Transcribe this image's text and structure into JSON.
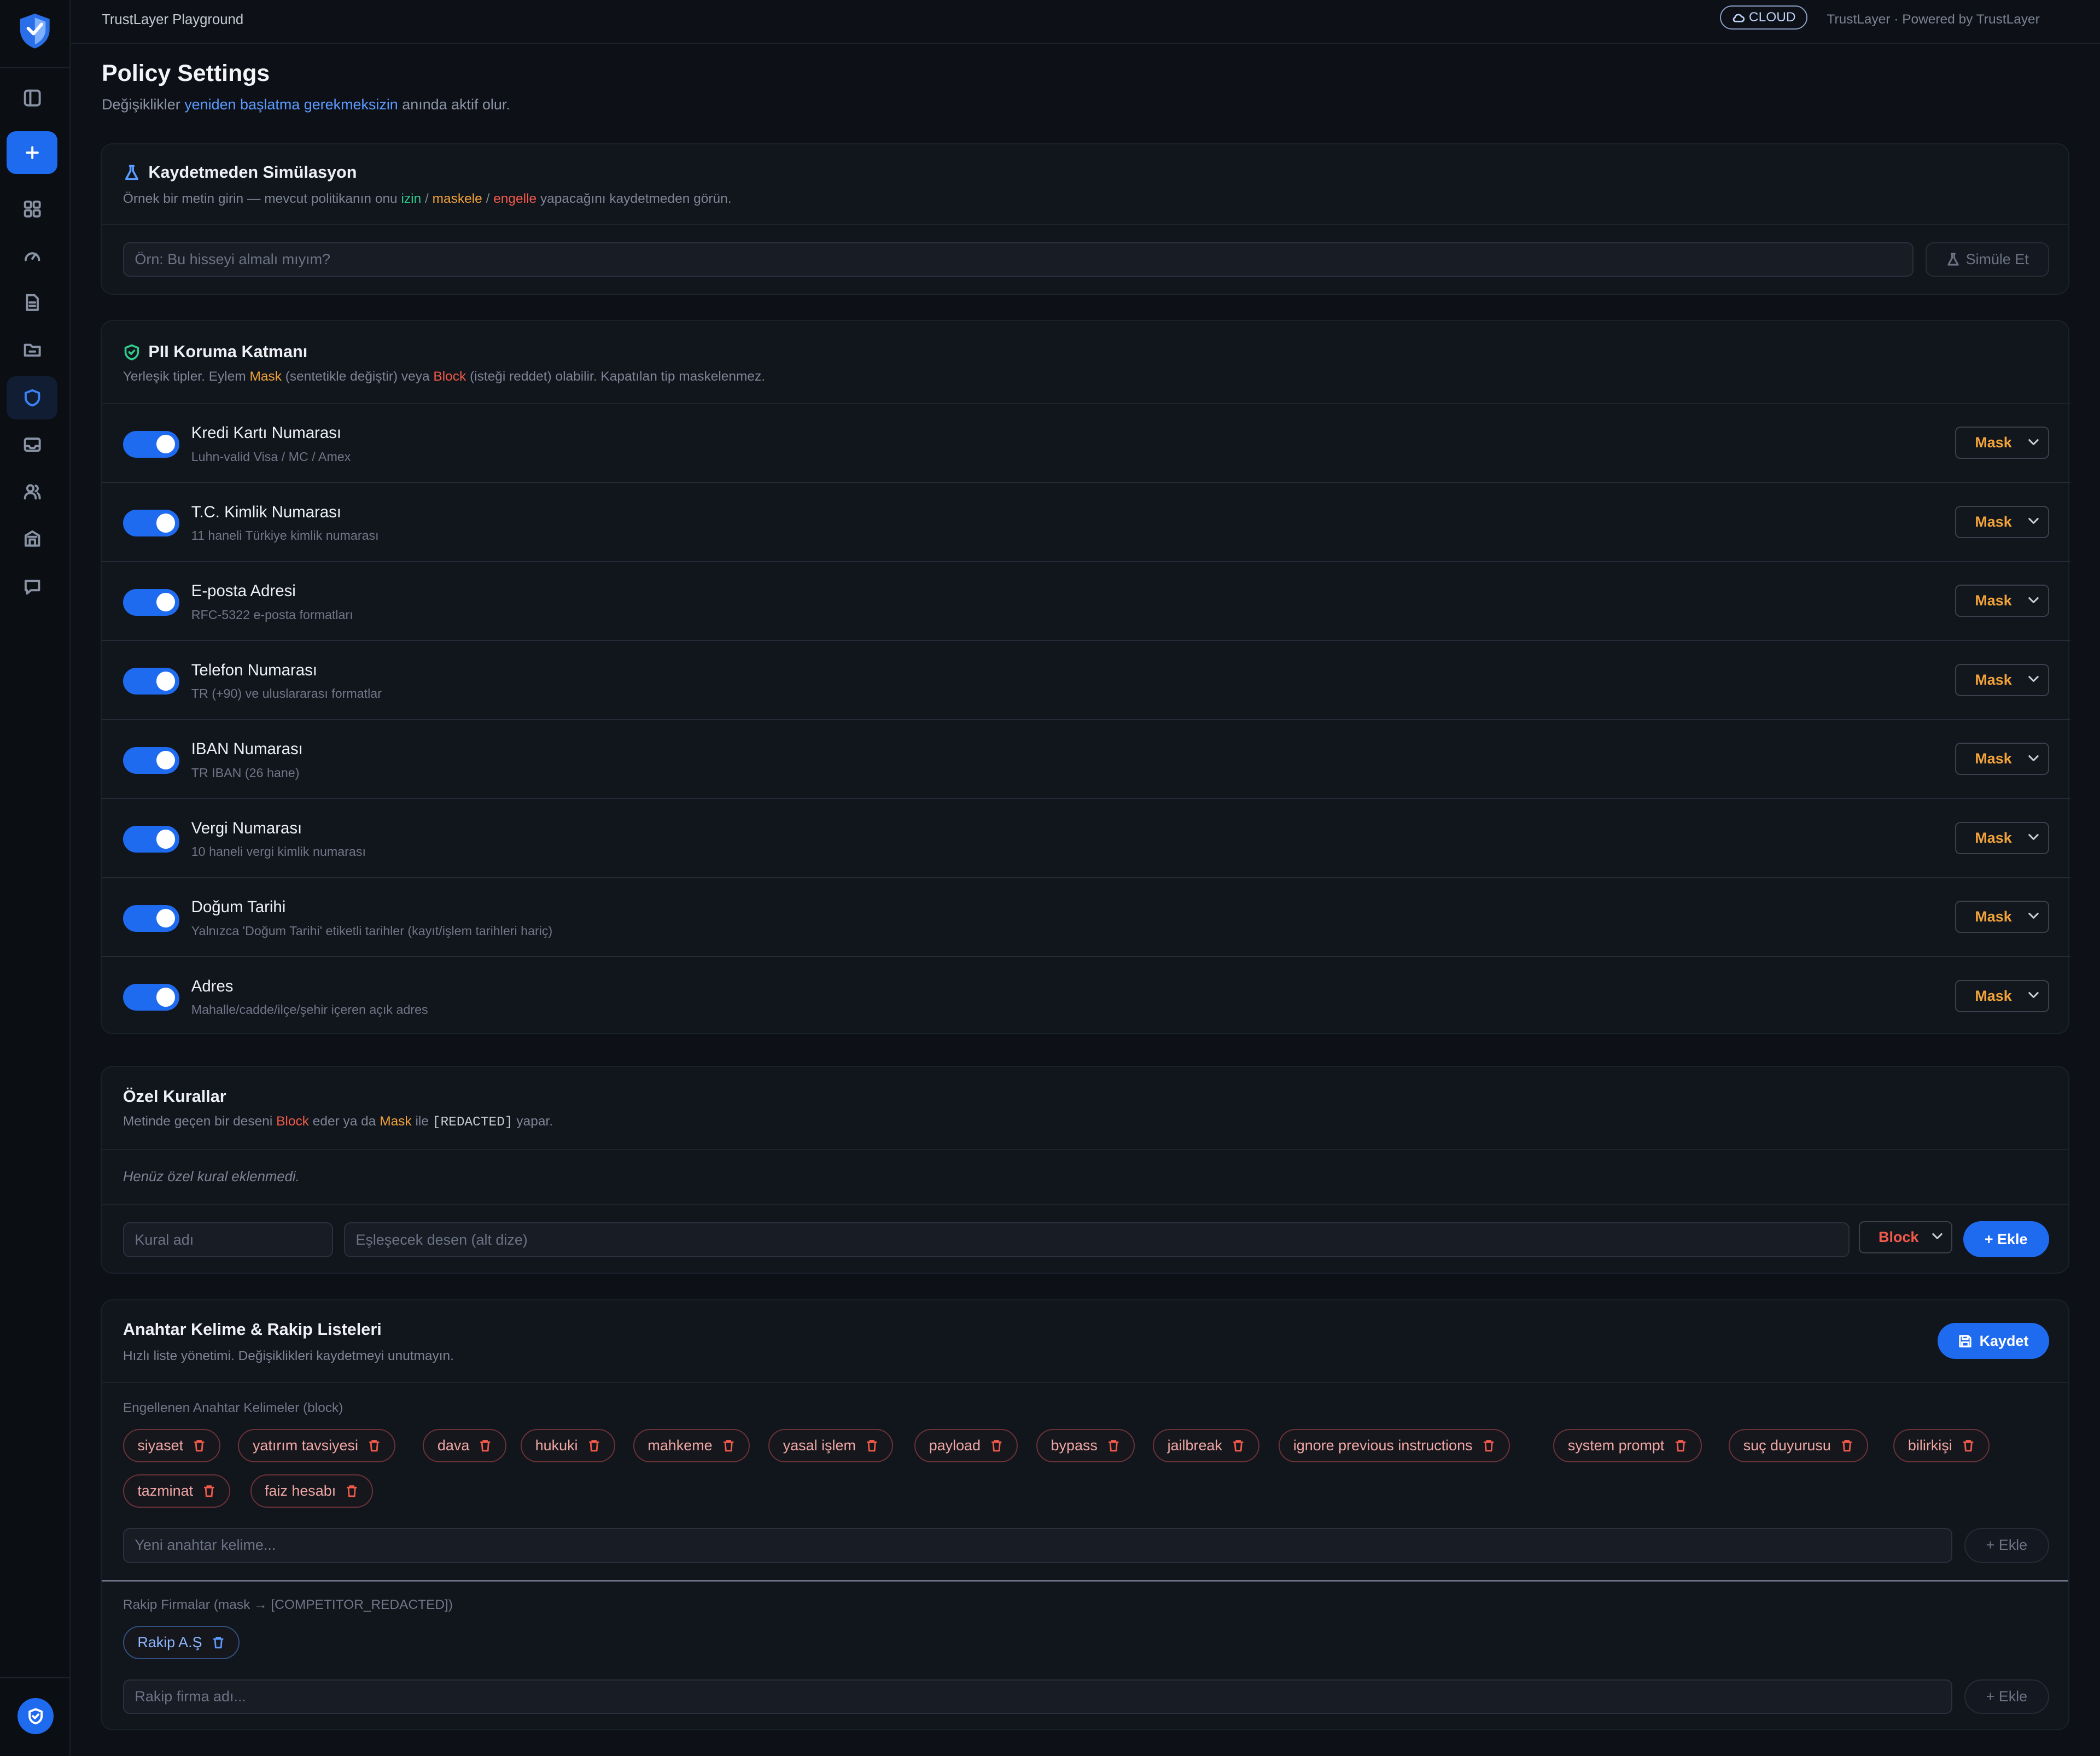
{
  "app": {
    "title": "TrustLayer Playground",
    "cloud_badge": "CLOUD",
    "powered_by": "TrustLayer · Powered by TrustLayer"
  },
  "sidebar": {
    "items": [
      "layout-icon",
      "plus-icon",
      "grid-icon",
      "gauge-icon",
      "document-icon",
      "folder-icon",
      "shield-icon",
      "inbox-icon",
      "users-icon",
      "building-icon",
      "chat-icon"
    ],
    "active": "shield-icon"
  },
  "page": {
    "title": "Policy Settings",
    "subtitle_pre": "Değişiklikler",
    "subtitle_link": "yeniden başlatma gerekmeksizin",
    "subtitle_post": "anında aktif olur."
  },
  "simulation": {
    "title": "Kaydetmeden Simülasyon",
    "desc_pre": "Örnek bir metin girin — mevcut politikanın onu",
    "desc_allow": "izin",
    "desc_sep1": "/",
    "desc_mask": "maskele",
    "desc_sep2": "/",
    "desc_block": "engelle",
    "desc_post": "yapacağını kaydetmeden görün.",
    "placeholder": "Örn: Bu hisseyi almalı mıyım?",
    "button": "Simüle Et"
  },
  "pii": {
    "title": "PII Koruma Katmanı",
    "desc_pre": "Yerleşik tipler. Eylem",
    "desc_mask": "Mask",
    "desc_mid": "(sentetikle değiştir) veya",
    "desc_block": "Block",
    "desc_post": "(isteği reddet) olabilir. Kapatılan tip maskelenmez.",
    "rows": [
      {
        "name": "Kredi Kartı Numarası",
        "desc": "Luhn-valid Visa / MC / Amex",
        "enabled": true,
        "action": "Mask"
      },
      {
        "name": "T.C. Kimlik Numarası",
        "desc": "11 haneli Türkiye kimlik numarası",
        "enabled": true,
        "action": "Mask"
      },
      {
        "name": "E-posta Adresi",
        "desc": "RFC-5322 e-posta formatları",
        "enabled": true,
        "action": "Mask"
      },
      {
        "name": "Telefon Numarası",
        "desc": "TR (+90) ve uluslararası formatlar",
        "enabled": true,
        "action": "Mask"
      },
      {
        "name": "IBAN Numarası",
        "desc": "TR IBAN (26 hane)",
        "enabled": true,
        "action": "Mask"
      },
      {
        "name": "Vergi Numarası",
        "desc": "10 haneli vergi kimlik numarası",
        "enabled": true,
        "action": "Mask"
      },
      {
        "name": "Doğum Tarihi",
        "desc": "Yalnızca 'Doğum Tarihi' etiketli tarihler (kayıt/işlem tarihleri hariç)",
        "enabled": true,
        "action": "Mask"
      },
      {
        "name": "Adres",
        "desc": "Mahalle/cadde/ilçe/şehir içeren açık adres",
        "enabled": true,
        "action": "Mask"
      }
    ]
  },
  "custom_rules": {
    "title": "Özel Kurallar",
    "desc_pre": "Metinde geçen bir deseni",
    "desc_block": "Block",
    "desc_mid": "eder ya da",
    "desc_mask": "Mask",
    "desc_mid2": "ile",
    "desc_code": "[REDACTED]",
    "desc_post": "yapar.",
    "empty": "Henüz özel kural eklenmedi.",
    "name_placeholder": "Kural adı",
    "pattern_placeholder": "Eşleşecek desen (alt dize)",
    "action": "Block",
    "add_button": "+ Ekle"
  },
  "keywords": {
    "title": "Anahtar Kelime & Rakip Listeleri",
    "desc": "Hızlı liste yönetimi. Değişiklikleri kaydetmeyi unutmayın.",
    "save_button": "Kaydet",
    "blocked_label": "Engellenen Anahtar Kelimeler (block)",
    "blocked": [
      "siyaset",
      "yatırım tavsiyesi",
      "dava",
      "hukuki",
      "mahkeme",
      "yasal işlem",
      "payload",
      "bypass",
      "jailbreak",
      "ignore previous instructions",
      "system prompt",
      "suç duyurusu",
      "bilirkişi",
      "tazminat",
      "faiz hesabı"
    ],
    "keyword_placeholder": "Yeni anahtar kelime...",
    "add_button": "+ Ekle",
    "competitor_label": "Rakip Firmalar (mask → [COMPETITOR_REDACTED])",
    "competitors": [
      "Rakip A.Ş"
    ],
    "competitor_placeholder": "Rakip firma adı...",
    "competitor_add_button": "+ Ekle"
  }
}
